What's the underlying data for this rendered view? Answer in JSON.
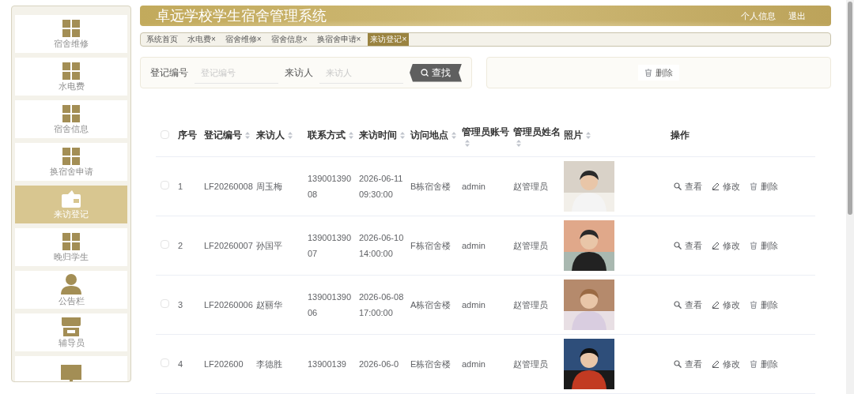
{
  "sidebar": {
    "items": [
      {
        "label": "宿舍维修",
        "kind": "grid",
        "selected": false
      },
      {
        "label": "水电费",
        "kind": "grid",
        "selected": false
      },
      {
        "label": "宿舍信息",
        "kind": "grid",
        "selected": false
      },
      {
        "label": "换宿舍申请",
        "kind": "grid",
        "selected": false
      },
      {
        "label": "来访登记",
        "kind": "wallet",
        "selected": true
      },
      {
        "label": "晚归学生",
        "kind": "grid",
        "selected": false
      },
      {
        "label": "公告栏",
        "kind": "person",
        "selected": false
      },
      {
        "label": "辅导员",
        "kind": "shop",
        "selected": false
      },
      {
        "kind": "monitor",
        "selected": false
      }
    ]
  },
  "header": {
    "title": "卓远学校学生宿舍管理系统",
    "links": [
      "个人信息",
      "退出"
    ]
  },
  "tabs": [
    {
      "label": "系统首页",
      "selected": false
    },
    {
      "label": "水电费",
      "close": "×",
      "selected": false
    },
    {
      "label": "宿舍维修",
      "close": "×",
      "selected": false
    },
    {
      "label": "宿舍信息",
      "close": "×",
      "selected": false
    },
    {
      "label": "换宿舍申请",
      "close": "×",
      "selected": false
    },
    {
      "label": "来访登记",
      "close": "×",
      "selected": true
    }
  ],
  "search": {
    "fields": [
      {
        "label": "登记编号",
        "placeholder": "登记编号"
      },
      {
        "label": "来访人",
        "placeholder": "来访人"
      }
    ],
    "button": "查找"
  },
  "toolbar": {
    "delete_button": "删除"
  },
  "table": {
    "all_checked": false,
    "columns": [
      {
        "label": "序号",
        "sortable": false
      },
      {
        "label": "登记编号",
        "sortable": true
      },
      {
        "label": "来访人",
        "sortable": true
      },
      {
        "label": "联系方式",
        "sortable": true
      },
      {
        "label": "来访时间",
        "sortable": true
      },
      {
        "label": "访问地点",
        "sortable": true
      },
      {
        "label": "管理员账号",
        "sortable": true
      },
      {
        "label": "管理员姓名",
        "sortable": true
      },
      {
        "label": "照片",
        "sortable": true
      },
      {
        "label": "操作",
        "sortable": false
      }
    ],
    "rows": [
      {
        "checked": false,
        "cells": [
          "1",
          "LF20260008",
          "周玉梅",
          "13900139008",
          "2026-06-11 09:30:00",
          "B栋宿舍楼",
          "admin",
          "赵管理员"
        ],
        "photo": {
          "kind": "picture"
        },
        "actions": [
          "查看",
          "修改",
          "删除"
        ]
      },
      {
        "checked": false,
        "cells": [
          "2",
          "LF20260007",
          "孙国平",
          "13900139007",
          "2026-06-10 14:00:00",
          "F栋宿舍楼",
          "admin",
          "赵管理员"
        ],
        "photo": {
          "kind": "picture"
        },
        "actions": [
          "查看",
          "修改",
          "删除"
        ]
      },
      {
        "checked": false,
        "cells": [
          "3",
          "LF20260006",
          "赵丽华",
          "13900139006",
          "2026-06-08 17:00:00",
          "A栋宿舍楼",
          "admin",
          "赵管理员"
        ],
        "photo": {
          "kind": "picture"
        },
        "actions": [
          "查看",
          "修改",
          "删除"
        ]
      },
      {
        "checked": false,
        "cells": [
          "4",
          "LF202600",
          "李德胜",
          "13900139",
          "2026-06-0",
          "E栋宿舍楼",
          "admin",
          "赵管理员"
        ],
        "photo": {
          "kind": "picture"
        },
        "actions": [
          "查看",
          "修改",
          "删除"
        ]
      }
    ]
  }
}
